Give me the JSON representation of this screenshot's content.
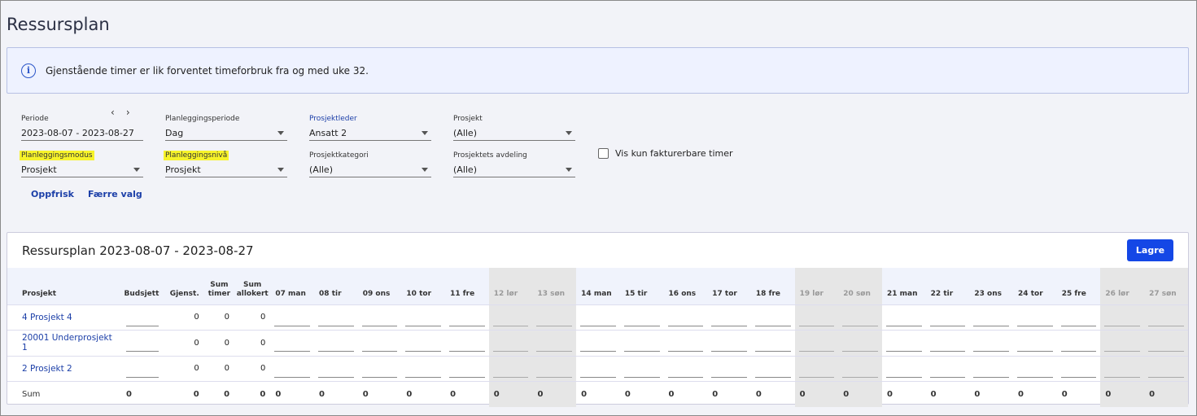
{
  "page": {
    "title": "Ressursplan"
  },
  "info": {
    "text": "Gjenstående timer er lik forventet timeforbruk fra og med uke 32."
  },
  "filters": {
    "periode": {
      "label": "Periode",
      "value": "2023-08-07 - 2023-08-27",
      "prev": "‹",
      "next": "›"
    },
    "planleggingsperiode": {
      "label": "Planleggingsperiode",
      "value": "Dag"
    },
    "prosjektleder": {
      "label": "Prosjektleder",
      "value": "Ansatt 2"
    },
    "prosjekt": {
      "label": "Prosjekt",
      "value": "(Alle)"
    },
    "planleggingsmodus": {
      "label": "Planleggingsmodus",
      "value": "Prosjekt"
    },
    "planleggingsniva": {
      "label": "Planleggingsnivå",
      "value": "Prosjekt"
    },
    "prosjektkategori": {
      "label": "Prosjektkategori",
      "value": "(Alle)"
    },
    "avdeling": {
      "label": "Prosjektets avdeling",
      "value": "(Alle)"
    },
    "fakturerbare": {
      "label": "Vis kun fakturerbare timer",
      "checked": false
    }
  },
  "actions": {
    "refresh": "Oppfrisk",
    "fewer": "Færre valg"
  },
  "plan": {
    "title": "Ressursplan 2023-08-07 - 2023-08-27",
    "save": "Lagre",
    "columns": {
      "project": "Prosjekt",
      "budget": "Budsjett",
      "remaining": "Gjenst.",
      "sum_hours_1": "Sum",
      "sum_hours_2": "timer",
      "sum_alloc_1": "Sum",
      "sum_alloc_2": "allokert"
    },
    "days": [
      {
        "label": "07 man",
        "weekend": false
      },
      {
        "label": "08 tir",
        "weekend": false
      },
      {
        "label": "09 ons",
        "weekend": false
      },
      {
        "label": "10 tor",
        "weekend": false
      },
      {
        "label": "11 fre",
        "weekend": false
      },
      {
        "label": "12 lør",
        "weekend": true
      },
      {
        "label": "13 søn",
        "weekend": true
      },
      {
        "label": "14 man",
        "weekend": false
      },
      {
        "label": "15 tir",
        "weekend": false
      },
      {
        "label": "16 ons",
        "weekend": false
      },
      {
        "label": "17 tor",
        "weekend": false
      },
      {
        "label": "18 fre",
        "weekend": false
      },
      {
        "label": "19 lør",
        "weekend": true
      },
      {
        "label": "20 søn",
        "weekend": true
      },
      {
        "label": "21 man",
        "weekend": false
      },
      {
        "label": "22 tir",
        "weekend": false
      },
      {
        "label": "23 ons",
        "weekend": false
      },
      {
        "label": "24 tor",
        "weekend": false
      },
      {
        "label": "25 fre",
        "weekend": false
      },
      {
        "label": "26 lør",
        "weekend": true
      },
      {
        "label": "27 søn",
        "weekend": true
      }
    ],
    "rows": [
      {
        "name": "4 Prosjekt 4",
        "remaining": "0",
        "sum_hours": "0",
        "sum_alloc": "0"
      },
      {
        "name": "20001 Underprosjekt 1",
        "remaining": "0",
        "sum_hours": "0",
        "sum_alloc": "0"
      },
      {
        "name": "2 Prosjekt 2",
        "remaining": "0",
        "sum_hours": "0",
        "sum_alloc": "0"
      }
    ],
    "sum_row": {
      "label": "Sum",
      "budget": "0",
      "remaining": "0",
      "sum_hours": "0",
      "sum_alloc": "0",
      "days": [
        "0",
        "0",
        "0",
        "0",
        "0",
        "0",
        "0",
        "0",
        "0",
        "0",
        "0",
        "0",
        "0",
        "0",
        "0",
        "0",
        "0",
        "0",
        "0",
        "0",
        "0"
      ]
    }
  }
}
